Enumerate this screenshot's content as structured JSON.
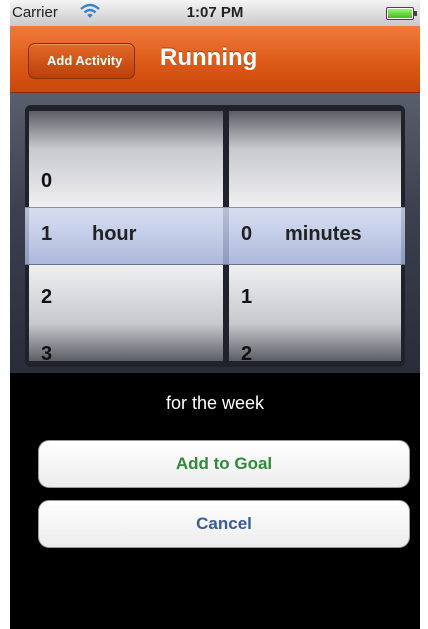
{
  "status_bar": {
    "carrier": "Carrier",
    "time": "1:07 PM",
    "icons": [
      "wifi-icon",
      "battery-icon"
    ]
  },
  "navbar": {
    "back_label": "Add Activity",
    "title": "Running",
    "color": "#dd5b18"
  },
  "picker": {
    "hours": {
      "above_2": "",
      "above": "0",
      "selected": "1",
      "unit": "hour",
      "below": "2",
      "below_2": "3"
    },
    "minutes": {
      "above_2": "",
      "above": "",
      "selected": "0",
      "unit": "minutes",
      "below": "1",
      "below_2": "2"
    }
  },
  "period_text": "for the week",
  "buttons": {
    "add_label": "Add to Goal",
    "add_color": "#2e8b3a",
    "cancel_label": "Cancel",
    "cancel_color": "#3a5a9a"
  }
}
